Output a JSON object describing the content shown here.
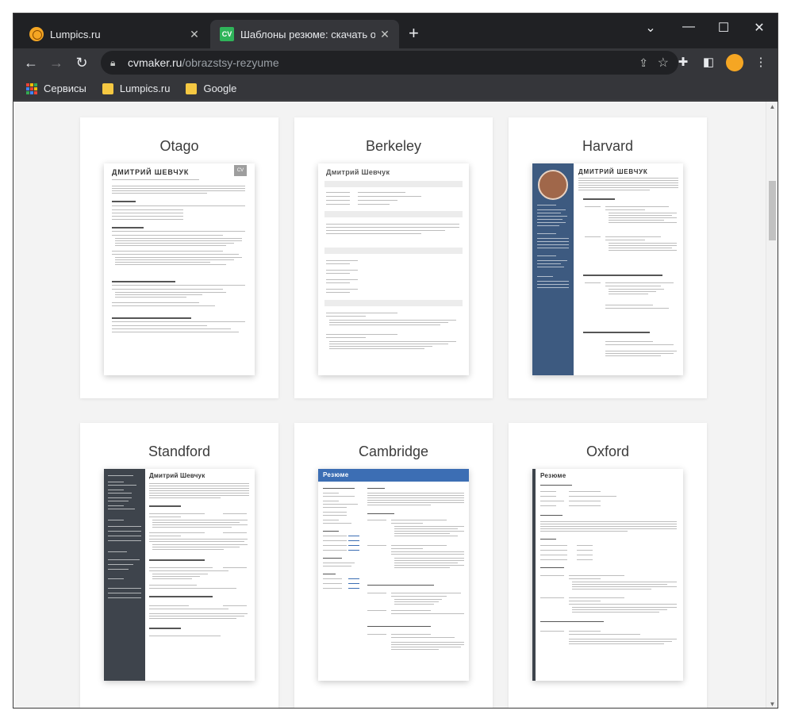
{
  "browser": {
    "tabs": [
      {
        "title": "Lumpics.ru",
        "close": "✕"
      },
      {
        "title": "Шаблоны резюме: скачать обр",
        "close": "✕",
        "favicon_text": "CV"
      }
    ],
    "new_tab": "+",
    "window_controls": {
      "minimize": "—",
      "maximize": "☐",
      "close": "✕"
    },
    "address": {
      "host": "cvmaker.ru",
      "path": "/obrazstsy-rezyume"
    },
    "bookmarks": [
      {
        "label": "Сервисы"
      },
      {
        "label": "Lumpics.ru"
      },
      {
        "label": "Google"
      }
    ]
  },
  "templates": [
    {
      "name": "Otago",
      "resume_name": "ДМИТРИЙ ШЕВЧУК",
      "cv_badge": "CV"
    },
    {
      "name": "Berkeley",
      "resume_name": "Дмитрий Шевчук"
    },
    {
      "name": "Harvard",
      "resume_name": "ДМИТРИЙ ШЕВЧУК"
    },
    {
      "name": "Standford",
      "resume_name": "Дмитрий Шевчук"
    },
    {
      "name": "Cambridge",
      "resume_name": "Резюме"
    },
    {
      "name": "Oxford",
      "resume_name": "Резюме"
    }
  ],
  "colors": {
    "chrome_dark": "#202124",
    "chrome_toolbar": "#35363a",
    "page_bg": "#f3f3f3",
    "harvard_sidebar": "#3d5a80",
    "standford_sidebar": "#3e444c",
    "cambridge_header": "#3c6eb4"
  }
}
